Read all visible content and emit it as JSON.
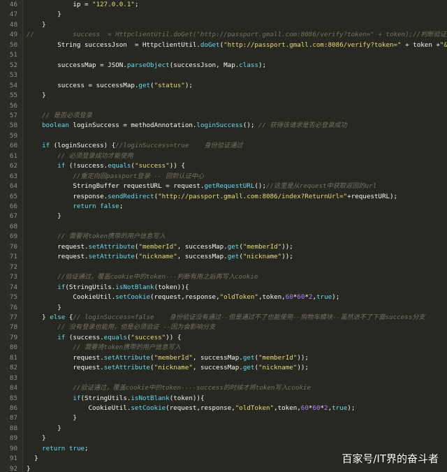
{
  "editor": {
    "colors": {
      "background": "#272822",
      "keyword": "#66d9ef",
      "string": "#e6db74",
      "number": "#ae81ff",
      "comment": "#75715e",
      "plain": "#f8f8f2"
    },
    "lines": [
      {
        "n": "46",
        "tokens": [
          {
            "t": "            ip = ",
            "k": "pl"
          },
          {
            "t": "\"127.0.0.1\"",
            "k": "str"
          },
          {
            "t": ";",
            "k": "pl"
          }
        ]
      },
      {
        "n": "47",
        "tokens": [
          {
            "t": "        }",
            "k": "pl"
          }
        ]
      },
      {
        "n": "48",
        "tokens": [
          {
            "t": "    }",
            "k": "pl"
          }
        ]
      },
      {
        "n": "49",
        "tokens": [
          {
            "t": "//          success  = HttpclientUtil.doGet(\"http://passport.gmall.com:8086/verify?token=\" + token);//判断验证是否",
            "k": "cm"
          }
        ]
      },
      {
        "n": "50",
        "tokens": [
          {
            "t": "        String successJson  = HttpclientUtil.",
            "k": "pl"
          },
          {
            "t": "doGet",
            "k": "fn"
          },
          {
            "t": "(",
            "k": "pl"
          },
          {
            "t": "\"http://passport.gmall.com:8086/verify?token=\"",
            "k": "str"
          },
          {
            "t": " + token +",
            "k": "pl"
          },
          {
            "t": "\"&cur",
            "k": "str"
          }
        ]
      },
      {
        "n": "51",
        "tokens": []
      },
      {
        "n": "52",
        "tokens": [
          {
            "t": "        successMap = JSON.",
            "k": "pl"
          },
          {
            "t": "parseObject",
            "k": "fn"
          },
          {
            "t": "(successJson, Map.",
            "k": "pl"
          },
          {
            "t": "class",
            "k": "kw"
          },
          {
            "t": ");",
            "k": "pl"
          }
        ]
      },
      {
        "n": "53",
        "tokens": []
      },
      {
        "n": "54",
        "tokens": [
          {
            "t": "        success = successMap.",
            "k": "pl"
          },
          {
            "t": "get",
            "k": "fn"
          },
          {
            "t": "(",
            "k": "pl"
          },
          {
            "t": "\"status\"",
            "k": "str"
          },
          {
            "t": ");",
            "k": "pl"
          }
        ]
      },
      {
        "n": "55",
        "tokens": [
          {
            "t": "    }",
            "k": "pl"
          }
        ]
      },
      {
        "n": "56",
        "tokens": []
      },
      {
        "n": "57",
        "tokens": [
          {
            "t": "    // 是否必须登录",
            "k": "cm"
          }
        ]
      },
      {
        "n": "58",
        "tokens": [
          {
            "t": "    ",
            "k": "pl"
          },
          {
            "t": "boolean",
            "k": "kw"
          },
          {
            "t": " loginSuccess = methodAnnotation.",
            "k": "pl"
          },
          {
            "t": "loginSuccess",
            "k": "fn"
          },
          {
            "t": "(); ",
            "k": "pl"
          },
          {
            "t": "// 获得该请求是否必登录成功",
            "k": "cm"
          }
        ]
      },
      {
        "n": "59",
        "tokens": []
      },
      {
        "n": "60",
        "tokens": [
          {
            "t": "    ",
            "k": "pl"
          },
          {
            "t": "if",
            "k": "kw"
          },
          {
            "t": " (loginSuccess) {",
            "k": "pl"
          },
          {
            "t": "//loginSuccess=true    身份验证通过",
            "k": "cm"
          }
        ]
      },
      {
        "n": "61",
        "tokens": [
          {
            "t": "        // 必须登录成功才能使用",
            "k": "cm"
          }
        ]
      },
      {
        "n": "62",
        "tokens": [
          {
            "t": "        ",
            "k": "pl"
          },
          {
            "t": "if",
            "k": "kw"
          },
          {
            "t": " (!success.",
            "k": "pl"
          },
          {
            "t": "equals",
            "k": "fn"
          },
          {
            "t": "(",
            "k": "pl"
          },
          {
            "t": "\"success\"",
            "k": "str"
          },
          {
            "t": ")) {",
            "k": "pl"
          }
        ]
      },
      {
        "n": "63",
        "tokens": [
          {
            "t": "            //重定向回passport登录 -- 回到认证中心",
            "k": "cm"
          }
        ]
      },
      {
        "n": "64",
        "tokens": [
          {
            "t": "            StringBuffer requestURL = request.",
            "k": "pl"
          },
          {
            "t": "getRequestURL",
            "k": "fn"
          },
          {
            "t": "();",
            "k": "pl"
          },
          {
            "t": "//这里是从request中获取返回的url",
            "k": "cm"
          }
        ]
      },
      {
        "n": "65",
        "tokens": [
          {
            "t": "            response.",
            "k": "pl"
          },
          {
            "t": "sendRedirect",
            "k": "fn"
          },
          {
            "t": "(",
            "k": "pl"
          },
          {
            "t": "\"http://passport.gmall.com:8086/index?ReturnUrl=\"",
            "k": "str"
          },
          {
            "t": "+requestURL);",
            "k": "pl"
          }
        ]
      },
      {
        "n": "66",
        "tokens": [
          {
            "t": "            ",
            "k": "pl"
          },
          {
            "t": "return",
            "k": "kw"
          },
          {
            "t": " ",
            "k": "pl"
          },
          {
            "t": "false",
            "k": "kw"
          },
          {
            "t": ";",
            "k": "pl"
          }
        ]
      },
      {
        "n": "67",
        "tokens": [
          {
            "t": "        }",
            "k": "pl"
          }
        ]
      },
      {
        "n": "68",
        "tokens": []
      },
      {
        "n": "69",
        "tokens": [
          {
            "t": "        // 需要将token携带的用户信息写入",
            "k": "cm"
          }
        ]
      },
      {
        "n": "70",
        "tokens": [
          {
            "t": "        request.",
            "k": "pl"
          },
          {
            "t": "setAttribute",
            "k": "fn"
          },
          {
            "t": "(",
            "k": "pl"
          },
          {
            "t": "\"memberId\"",
            "k": "str"
          },
          {
            "t": ", successMap.",
            "k": "pl"
          },
          {
            "t": "get",
            "k": "fn"
          },
          {
            "t": "(",
            "k": "pl"
          },
          {
            "t": "\"memberId\"",
            "k": "str"
          },
          {
            "t": "));",
            "k": "pl"
          }
        ]
      },
      {
        "n": "71",
        "tokens": [
          {
            "t": "        request.",
            "k": "pl"
          },
          {
            "t": "setAttribute",
            "k": "fn"
          },
          {
            "t": "(",
            "k": "pl"
          },
          {
            "t": "\"nickname\"",
            "k": "str"
          },
          {
            "t": ", successMap.",
            "k": "pl"
          },
          {
            "t": "get",
            "k": "fn"
          },
          {
            "t": "(",
            "k": "pl"
          },
          {
            "t": "\"nickname\"",
            "k": "str"
          },
          {
            "t": "));",
            "k": "pl"
          }
        ]
      },
      {
        "n": "72",
        "tokens": []
      },
      {
        "n": "73",
        "tokens": [
          {
            "t": "        //验证通过，覆盖cookie中的token---判断有用之后再写入cookie",
            "k": "cm"
          }
        ]
      },
      {
        "n": "74",
        "tokens": [
          {
            "t": "        ",
            "k": "pl"
          },
          {
            "t": "if",
            "k": "kw"
          },
          {
            "t": "(StringUtils.",
            "k": "pl"
          },
          {
            "t": "isNotBlank",
            "k": "fn"
          },
          {
            "t": "(token)){",
            "k": "pl"
          }
        ]
      },
      {
        "n": "75",
        "tokens": [
          {
            "t": "            CookieUtil.",
            "k": "pl"
          },
          {
            "t": "setCookie",
            "k": "fn"
          },
          {
            "t": "(request,response,",
            "k": "pl"
          },
          {
            "t": "\"oldToken\"",
            "k": "str"
          },
          {
            "t": ",token,",
            "k": "pl"
          },
          {
            "t": "60",
            "k": "num"
          },
          {
            "t": "*",
            "k": "pl"
          },
          {
            "t": "60",
            "k": "num"
          },
          {
            "t": "*",
            "k": "pl"
          },
          {
            "t": "2",
            "k": "num"
          },
          {
            "t": ",",
            "k": "pl"
          },
          {
            "t": "true",
            "k": "kw"
          },
          {
            "t": ");",
            "k": "pl"
          }
        ]
      },
      {
        "n": "76",
        "tokens": [
          {
            "t": "        }",
            "k": "pl"
          }
        ]
      },
      {
        "n": "77",
        "tokens": [
          {
            "t": "    } ",
            "k": "pl"
          },
          {
            "t": "else",
            "k": "kw"
          },
          {
            "t": " {",
            "k": "pl"
          },
          {
            "t": "// loginSuccess=false    身份验证没有通过--但是通过不了也能使用--购物车模块--虽然进不了下面success分支",
            "k": "cm"
          }
        ]
      },
      {
        "n": "78",
        "tokens": [
          {
            "t": "        // 没有登录也能用，但是必须验证 --因为会影响分支",
            "k": "cm"
          }
        ]
      },
      {
        "n": "79",
        "tokens": [
          {
            "t": "        ",
            "k": "pl"
          },
          {
            "t": "if",
            "k": "kw"
          },
          {
            "t": " (success.",
            "k": "pl"
          },
          {
            "t": "equals",
            "k": "fn"
          },
          {
            "t": "(",
            "k": "pl"
          },
          {
            "t": "\"success\"",
            "k": "str"
          },
          {
            "t": ")) {",
            "k": "pl"
          }
        ]
      },
      {
        "n": "80",
        "tokens": [
          {
            "t": "            // 需要将token携带的用户信息写入",
            "k": "cm"
          }
        ]
      },
      {
        "n": "81",
        "tokens": [
          {
            "t": "            request.",
            "k": "pl"
          },
          {
            "t": "setAttribute",
            "k": "fn"
          },
          {
            "t": "(",
            "k": "pl"
          },
          {
            "t": "\"memberId\"",
            "k": "str"
          },
          {
            "t": ", successMap.",
            "k": "pl"
          },
          {
            "t": "get",
            "k": "fn"
          },
          {
            "t": "(",
            "k": "pl"
          },
          {
            "t": "\"memberId\"",
            "k": "str"
          },
          {
            "t": "));",
            "k": "pl"
          }
        ]
      },
      {
        "n": "82",
        "tokens": [
          {
            "t": "            request.",
            "k": "pl"
          },
          {
            "t": "setAttribute",
            "k": "fn"
          },
          {
            "t": "(",
            "k": "pl"
          },
          {
            "t": "\"nickname\"",
            "k": "str"
          },
          {
            "t": ", successMap.",
            "k": "pl"
          },
          {
            "t": "get",
            "k": "fn"
          },
          {
            "t": "(",
            "k": "pl"
          },
          {
            "t": "\"nickname\"",
            "k": "str"
          },
          {
            "t": "));",
            "k": "pl"
          }
        ]
      },
      {
        "n": "83",
        "tokens": []
      },
      {
        "n": "84",
        "tokens": [
          {
            "t": "            //验证通过，覆盖cookie中的token----success的时候才将token写入cookie",
            "k": "cm"
          }
        ]
      },
      {
        "n": "85",
        "tokens": [
          {
            "t": "            ",
            "k": "pl"
          },
          {
            "t": "if",
            "k": "kw"
          },
          {
            "t": "(StringUtils.",
            "k": "pl"
          },
          {
            "t": "isNotBlank",
            "k": "fn"
          },
          {
            "t": "(token)){",
            "k": "pl"
          }
        ]
      },
      {
        "n": "86",
        "tokens": [
          {
            "t": "                CookieUtil.",
            "k": "pl"
          },
          {
            "t": "setCookie",
            "k": "fn"
          },
          {
            "t": "(request,response,",
            "k": "pl"
          },
          {
            "t": "\"oldToken\"",
            "k": "str"
          },
          {
            "t": ",token,",
            "k": "pl"
          },
          {
            "t": "60",
            "k": "num"
          },
          {
            "t": "*",
            "k": "pl"
          },
          {
            "t": "60",
            "k": "num"
          },
          {
            "t": "*",
            "k": "pl"
          },
          {
            "t": "2",
            "k": "num"
          },
          {
            "t": ",",
            "k": "pl"
          },
          {
            "t": "true",
            "k": "kw"
          },
          {
            "t": ");",
            "k": "pl"
          }
        ]
      },
      {
        "n": "87",
        "tokens": [
          {
            "t": "            }",
            "k": "pl"
          }
        ]
      },
      {
        "n": "88",
        "tokens": [
          {
            "t": "        }",
            "k": "pl"
          }
        ]
      },
      {
        "n": "89",
        "tokens": [
          {
            "t": "    }",
            "k": "pl"
          }
        ]
      },
      {
        "n": "90",
        "tokens": [
          {
            "t": "    ",
            "k": "pl"
          },
          {
            "t": "return",
            "k": "kw"
          },
          {
            "t": " ",
            "k": "pl"
          },
          {
            "t": "true",
            "k": "kw"
          },
          {
            "t": ";",
            "k": "pl"
          }
        ]
      },
      {
        "n": "91",
        "tokens": [
          {
            "t": "  }",
            "k": "pl"
          }
        ]
      },
      {
        "n": "92",
        "tokens": [
          {
            "t": "}",
            "k": "pl"
          }
        ]
      }
    ]
  },
  "watermark": {
    "text": "百家号/IT界的奋斗者"
  }
}
